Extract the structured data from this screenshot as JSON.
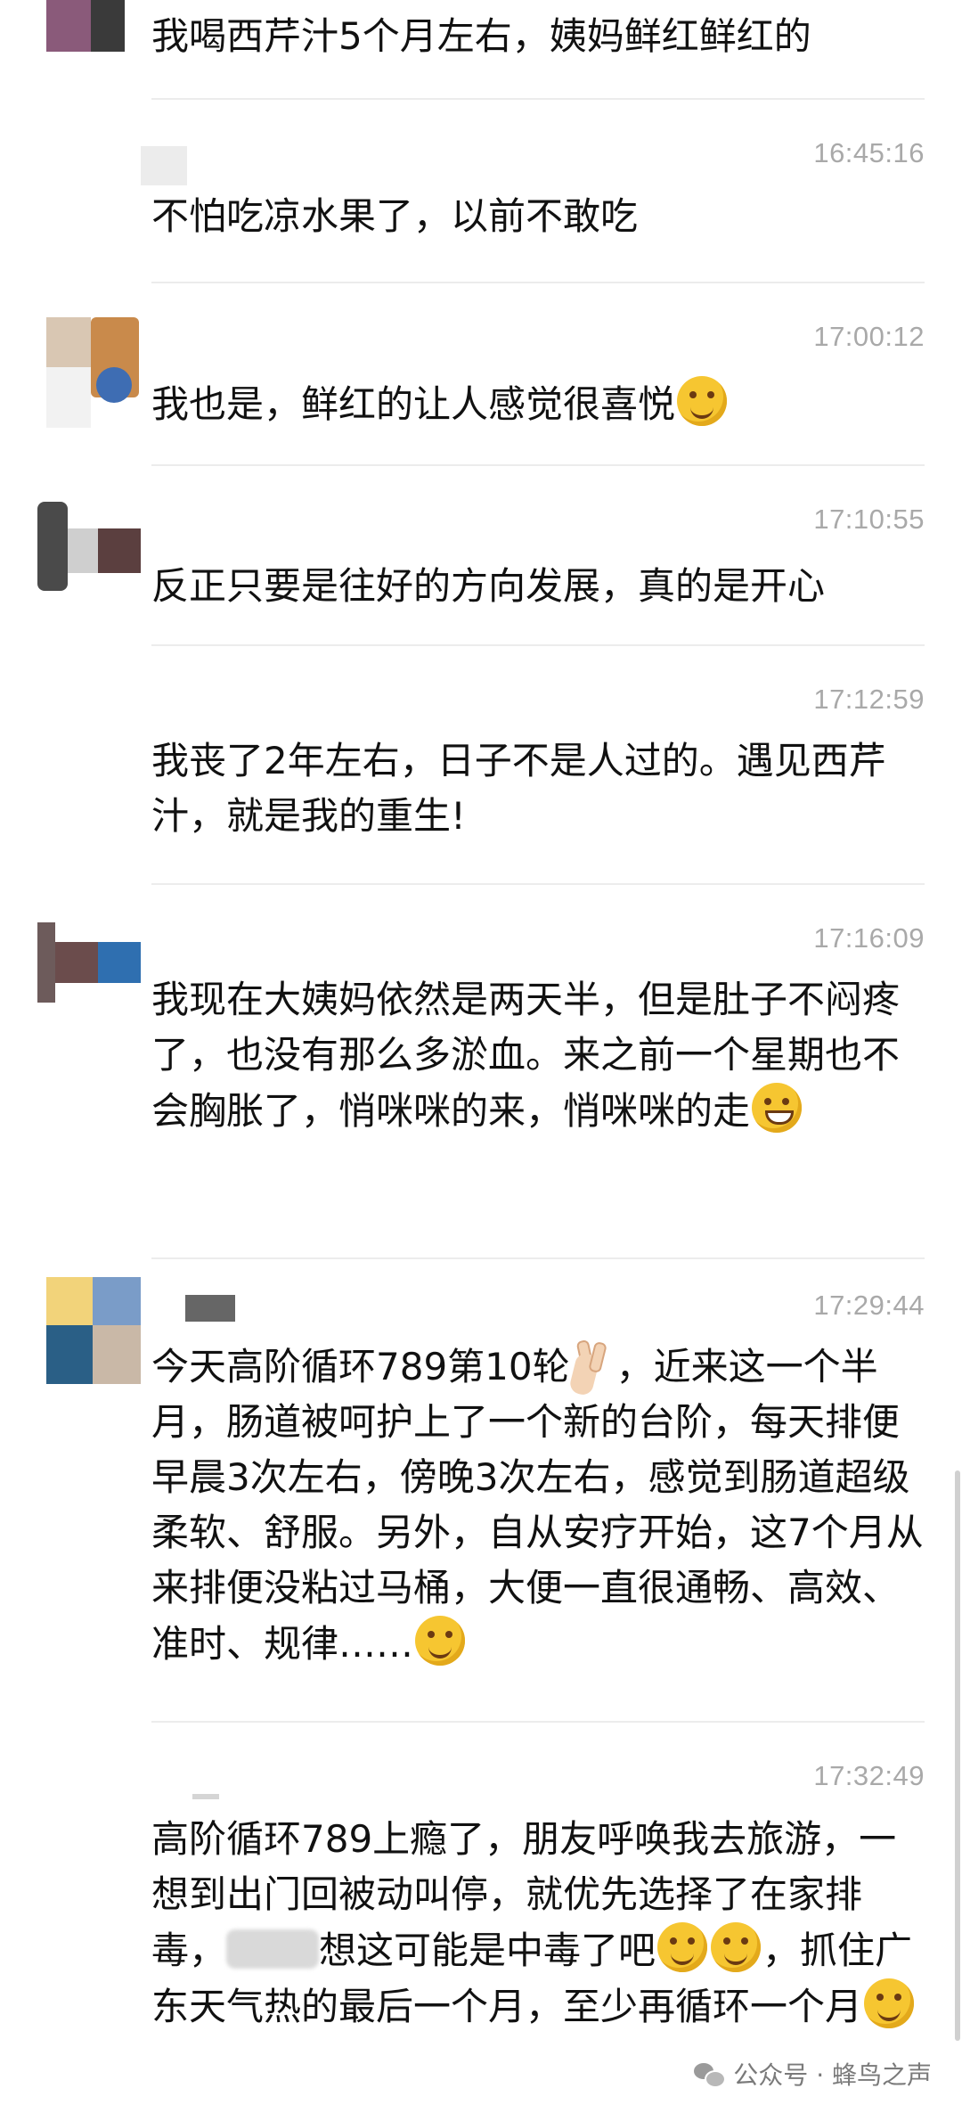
{
  "messages": [
    {
      "time": "",
      "name": "",
      "text_parts": [
        {
          "t": "我喝西芹汁5个月左右，姨妈鲜红鲜红的"
        }
      ]
    },
    {
      "time": "16:45:16",
      "name": "",
      "text_parts": [
        {
          "t": "不怕吃凉水果了，以前不敢吃"
        }
      ]
    },
    {
      "time": "17:00:12",
      "name": "",
      "text_parts": [
        {
          "t": "我也是，鲜红的让人感觉很喜悦"
        },
        {
          "e": "thinking-face-emoji"
        }
      ]
    },
    {
      "time": "17:10:55",
      "name": "",
      "text_parts": [
        {
          "t": "反正只要是往好的方向发展，真的是开心"
        }
      ]
    },
    {
      "time": "17:12:59",
      "name": "",
      "text_parts": [
        {
          "t": "我丧了2年左右，日子不是人过的。遇见西芹汁，就是我的重生!"
        }
      ]
    },
    {
      "time": "17:16:09",
      "name": "",
      "text_parts": [
        {
          "t": "我现在大姨妈依然是两天半，但是肚子不闷疼了，也没有那么多淤血。来之前一个星期也不会胸胀了，悄咪咪的来，悄咪咪的走"
        },
        {
          "e": "grin-emoji"
        }
      ]
    },
    {
      "time": "17:29:44",
      "name": "",
      "text_parts": [
        {
          "t": "今天高阶循环789第10轮"
        },
        {
          "e": "victory-hand-emoji"
        },
        {
          "t": "，近来这一个半月，肠道被呵护上了一个新的台阶，每天排便早晨3次左右，傍晚3次左右，感觉到肠道超级柔软、舒服。另外，自从安疗开始，这7个月从来排便没粘过马桶，大便一直很通畅、高效、准时、规律……"
        },
        {
          "e": "smirk-emoji"
        }
      ]
    },
    {
      "time": "17:32:49",
      "name": "",
      "text_parts": [
        {
          "t": "高阶循环789上瘾了，朋友呼唤我去旅游，一想到出门回被动叫停，就优先选择了在家排毒，"
        },
        {
          "b": "blurred-text"
        },
        {
          "t": "想这可能是中毒了吧"
        },
        {
          "e": "thinking-face-emoji"
        },
        {
          "e": "smirk-emoji"
        },
        {
          "t": "，抓住广东天气热的最后一个月，至少再循环一个月"
        },
        {
          "e": "smile-emoji"
        }
      ]
    }
  ],
  "watermark": {
    "icon": "wechat-icon",
    "label": "公众号 · 蜂鸟之声"
  },
  "colors": {
    "text": "#111111",
    "time": "#a9a9a9",
    "divider": "#ececec",
    "background": "#ffffff"
  }
}
